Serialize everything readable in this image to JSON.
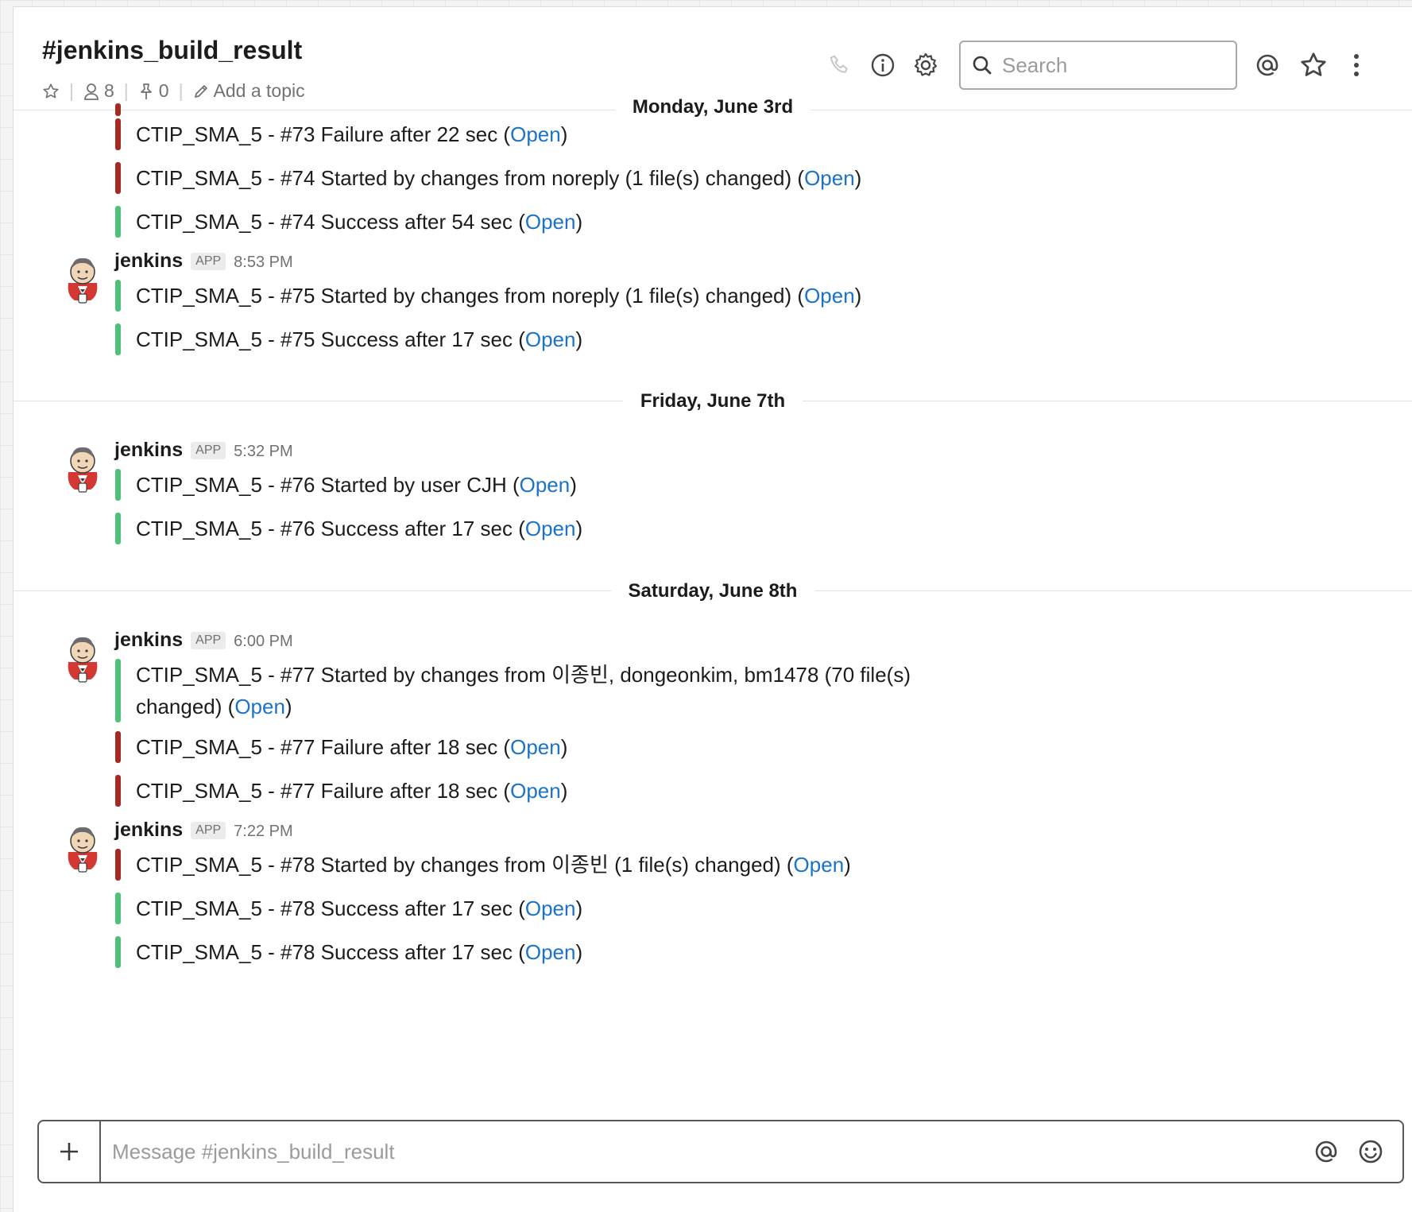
{
  "header": {
    "channel_name": "#jenkins_build_result",
    "member_count": "8",
    "pinned_count": "0",
    "topic_placeholder": "Add a topic",
    "search_placeholder": "Search"
  },
  "colors": {
    "failure": "#a52a22",
    "success": "#4ec07a",
    "link": "#1a73c8"
  },
  "days": [
    "Monday, June 3rd",
    "Friday, June 7th",
    "Saturday, June 8th"
  ],
  "author": {
    "name": "jenkins",
    "badge": "APP"
  },
  "timestamps": [
    "8:53 PM",
    "5:32 PM",
    "6:00 PM",
    "7:22 PM"
  ],
  "link_label": "Open",
  "attachments": [
    {
      "text": "CTIP_SMA_5 - #73 Failure after 22 sec (",
      "status": "failure"
    },
    {
      "text": "CTIP_SMA_5 - #74 Started by changes from noreply (1 file(s) changed) (",
      "status": "failure"
    },
    {
      "text": "CTIP_SMA_5 - #74 Success after 54 sec (",
      "status": "success"
    },
    {
      "text": "CTIP_SMA_5 - #75 Started by changes from noreply (1 file(s) changed) (",
      "status": "success"
    },
    {
      "text": "CTIP_SMA_5 - #75 Success after 17 sec (",
      "status": "success"
    },
    {
      "text": "CTIP_SMA_5 - #76 Started by user CJH (",
      "status": "success"
    },
    {
      "text": "CTIP_SMA_5 - #76 Success after 17 sec (",
      "status": "success"
    },
    {
      "text": "CTIP_SMA_5 - #77 Started by changes from 이종빈, dongeonkim, bm1478 (70 file(s)",
      "text2": "changed) (",
      "status": "success"
    },
    {
      "text": "CTIP_SMA_5 - #77 Failure after 18 sec (",
      "status": "failure"
    },
    {
      "text": "CTIP_SMA_5 - #77 Failure after 18 sec (",
      "status": "failure"
    },
    {
      "text": "CTIP_SMA_5 - #78 Started by changes from 이종빈 (1 file(s) changed) (",
      "status": "failure"
    },
    {
      "text": "CTIP_SMA_5 - #78 Success after 17 sec (",
      "status": "success"
    },
    {
      "text": "CTIP_SMA_5 - #78 Success after 17 sec (",
      "status": "success"
    }
  ],
  "composer": {
    "placeholder": "Message #jenkins_build_result"
  }
}
